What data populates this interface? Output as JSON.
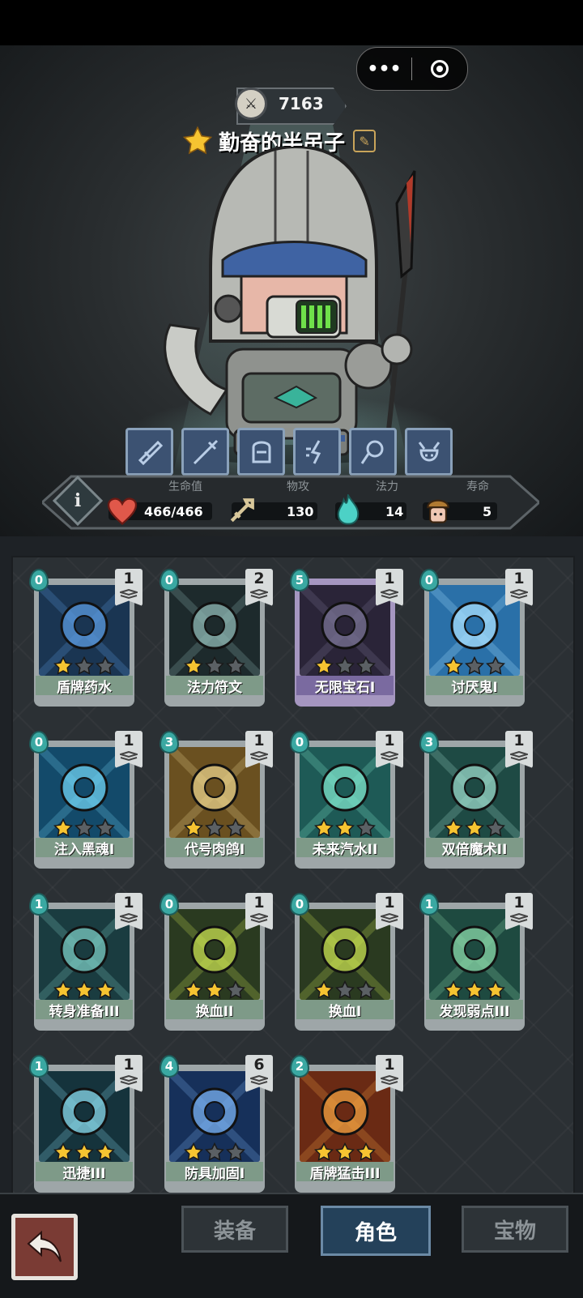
{
  "header": {
    "power_value": "7163",
    "hero_name": "勤奋的半吊子",
    "capsule_more": "•••"
  },
  "skills": [
    {
      "icon": "blade-skill-icon"
    },
    {
      "icon": "sword-skill-icon"
    },
    {
      "icon": "armor-skill-icon"
    },
    {
      "icon": "dash-skill-icon"
    },
    {
      "icon": "swirl-skill-icon"
    },
    {
      "icon": "demon-skill-icon"
    }
  ],
  "stats": {
    "hp_label": "生命值",
    "hp_value": "466/466",
    "atk_label": "物攻",
    "atk_value": "130",
    "mana_label": "法力",
    "mana_value": "14",
    "life_label": "寿命",
    "life_value": "5"
  },
  "cards": [
    {
      "name": "盾牌药水",
      "cost": "0",
      "count": "1",
      "stars": 1,
      "rarity": "normal"
    },
    {
      "name": "法力符文",
      "cost": "0",
      "count": "2",
      "stars": 1,
      "rarity": "normal"
    },
    {
      "name": "无限宝石I",
      "cost": "5",
      "count": "1",
      "stars": 1,
      "rarity": "epic"
    },
    {
      "name": "讨厌鬼I",
      "cost": "0",
      "count": "1",
      "stars": 1,
      "rarity": "normal"
    },
    {
      "name": "注入黑魂I",
      "cost": "0",
      "count": "1",
      "stars": 1,
      "rarity": "normal"
    },
    {
      "name": "代号肉鸽I",
      "cost": "3",
      "count": "1",
      "stars": 1,
      "rarity": "normal"
    },
    {
      "name": "未来汽水II",
      "cost": "0",
      "count": "1",
      "stars": 2,
      "rarity": "normal"
    },
    {
      "name": "双倍魔术II",
      "cost": "3",
      "count": "1",
      "stars": 2,
      "rarity": "normal"
    },
    {
      "name": "转身准备III",
      "cost": "1",
      "count": "1",
      "stars": 3,
      "rarity": "normal"
    },
    {
      "name": "换血II",
      "cost": "0",
      "count": "1",
      "stars": 2,
      "rarity": "normal"
    },
    {
      "name": "换血I",
      "cost": "0",
      "count": "1",
      "stars": 1,
      "rarity": "normal"
    },
    {
      "name": "发现弱点III",
      "cost": "1",
      "count": "1",
      "stars": 3,
      "rarity": "normal"
    },
    {
      "name": "迅捷III",
      "cost": "1",
      "count": "1",
      "stars": 3,
      "rarity": "normal"
    },
    {
      "name": "防具加固I",
      "cost": "4",
      "count": "6",
      "stars": 1,
      "rarity": "normal"
    },
    {
      "name": "盾牌猛击III",
      "cost": "2",
      "count": "1",
      "stars": 3,
      "rarity": "normal"
    }
  ],
  "tabs": {
    "equipment": "装备",
    "character": "角色",
    "treasure": "宝物",
    "active": "character"
  },
  "colors": {
    "star_gold": "#f6c431",
    "star_gray": "#5b6064",
    "cost_teal": "#3aa8a2",
    "banner_green": "#7e9a88",
    "banner_purple": "#7a6aa0"
  }
}
